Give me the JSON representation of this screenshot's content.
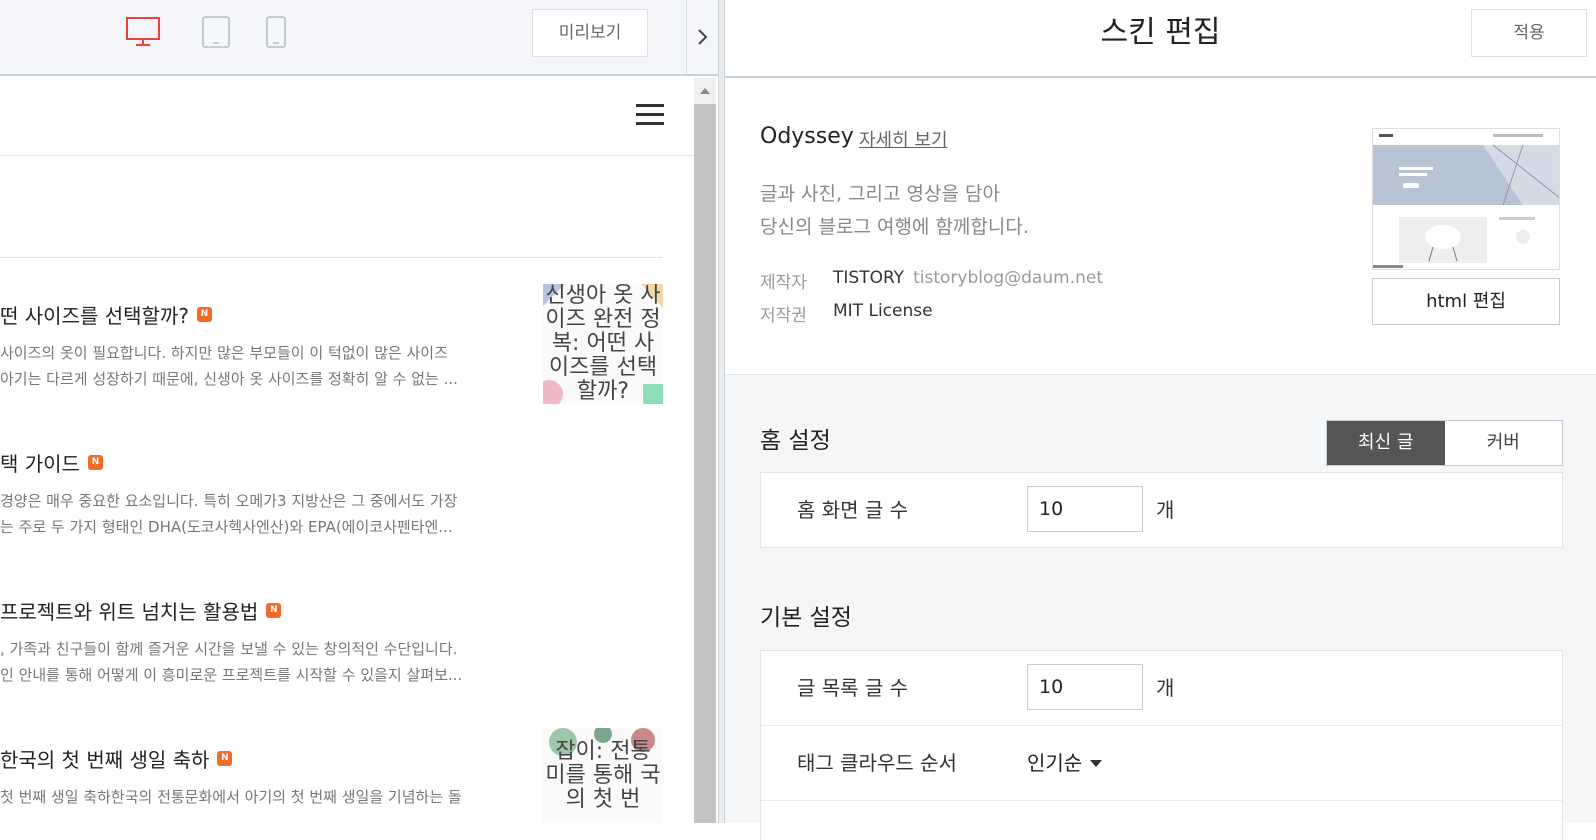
{
  "left_toolbar": {
    "devices": [
      "desktop-icon",
      "tablet-icon",
      "mobile-icon"
    ],
    "active_device": "desktop",
    "preview_label": "미리보기"
  },
  "blog": {
    "posts": [
      {
        "title": "떤 사이즈를 선택할까?",
        "badge": "N",
        "summary_1": "사이즈의 옷이 필요합니다. 하지만 많은 부모들이 이 턱없이 많은 사이즈",
        "summary_2": "아기는 다르게 성장하기 때문에, 신생아 옷 사이즈를 정확히 알 수 없는 ...",
        "thumb_text": "신생아 옷 사이즈 완전 정복: 어떤 사이즈를 선택할까?"
      },
      {
        "title": "택 가이드",
        "badge": "N",
        "summary_1": "경양은 매우 중요한 요소입니다. 특히 오메가3 지방산은 그 중에서도 가장",
        "summary_2": "는 주로 두 가지 형태인 DHA(도코사헥사엔산)와 EPA(에이코사펜타엔...",
        "thumb_text": ""
      },
      {
        "title": "프로젝트와 위트 넘치는 활용법",
        "badge": "N",
        "summary_1": ", 가족과 친구들이 함께 즐거운 시간을 보낼 수 있는 창의적인 수단입니다.",
        "summary_2": "인 안내를 통해 어떻게 이 흥미로운 프로젝트를 시작할 수 있을지 살펴보...",
        "thumb_text": ""
      },
      {
        "title": "한국의 첫 번째 생일 축하",
        "badge": "N",
        "summary_1": "첫 번째 생일 축하한국의 전통문화에서 아기의 첫 번째 생일을 기념하는 돌",
        "summary_2": "",
        "thumb_text": "잡이: 전통 미를 통해 국의 첫 번"
      }
    ]
  },
  "editor": {
    "title": "스킨 편집",
    "apply_label": "적용",
    "skin": {
      "name": "Odyssey",
      "detail_link": "자세히 보기",
      "desc_1": "글과 사진, 그리고 영상을 담아",
      "desc_2": "당신의 블로그 여행에 함께합니다.",
      "author_label": "제작자",
      "author": "TISTORY",
      "email": "tistoryblog@daum.net",
      "license_label": "저작권",
      "license": "MIT License",
      "html_edit_label": "html 편집"
    },
    "home": {
      "title": "홈 설정",
      "tab_latest": "최신 글",
      "tab_cover": "커버",
      "active_tab": "최신 글",
      "count_label": "홈 화면 글 수",
      "count_value": "10",
      "unit": "개"
    },
    "basic": {
      "title": "기본 설정",
      "list_count_label": "글 목록 글 수",
      "list_count_value": "10",
      "unit": "개",
      "tag_order_label": "태그 클라우드 순서",
      "tag_order_value": "인기순"
    }
  },
  "colors": {
    "accent_red": "#e8453c",
    "badge_orange": "#f26b2a",
    "tab_active_bg": "#555555"
  }
}
